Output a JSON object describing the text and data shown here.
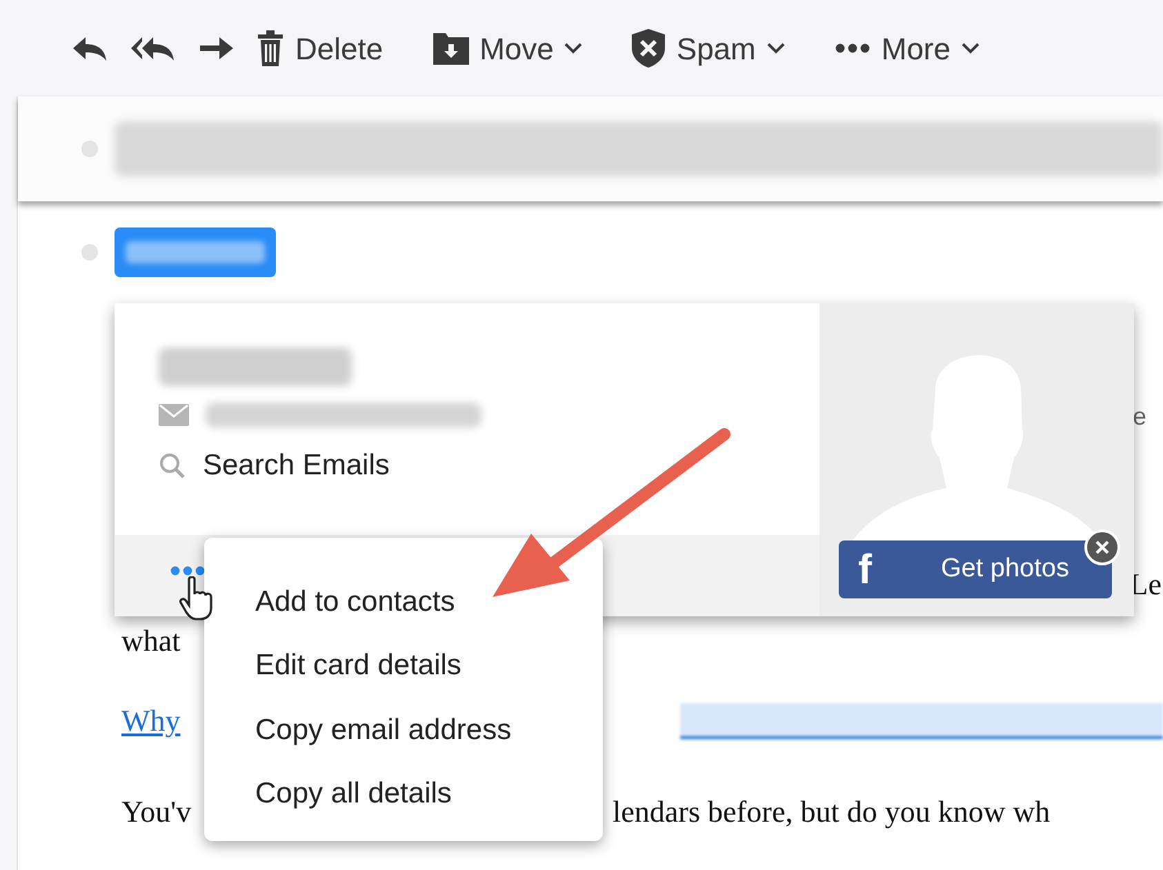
{
  "toolbar": {
    "buttons": [
      {
        "kind": "reply",
        "dropdown": false
      },
      {
        "kind": "reply-all",
        "dropdown": false
      },
      {
        "kind": "forward",
        "dropdown": false
      },
      {
        "kind": "delete",
        "label": "Delete",
        "dropdown": false
      },
      {
        "kind": "move",
        "label": "Move",
        "dropdown": true
      },
      {
        "kind": "spam",
        "label": "Spam",
        "dropdown": true
      },
      {
        "kind": "more",
        "label": "More",
        "dropdown": true
      }
    ]
  },
  "contact_card": {
    "actions": [
      {
        "kind": "search",
        "label": "Search Emails"
      }
    ],
    "facebook": {
      "glyph": "f",
      "label": "Get photos"
    }
  },
  "context_menu": {
    "items": [
      {
        "label": "Add to contacts"
      },
      {
        "label": "Edit card details"
      },
      {
        "label": "Copy email address"
      },
      {
        "label": "Copy all details"
      }
    ]
  },
  "body": {
    "right_fragments": [
      "e",
      "Le"
    ],
    "line_1": "what",
    "link": "Why",
    "line_2_start": "You'v",
    "line_2_end": "lendars before, but do you know wh"
  }
}
